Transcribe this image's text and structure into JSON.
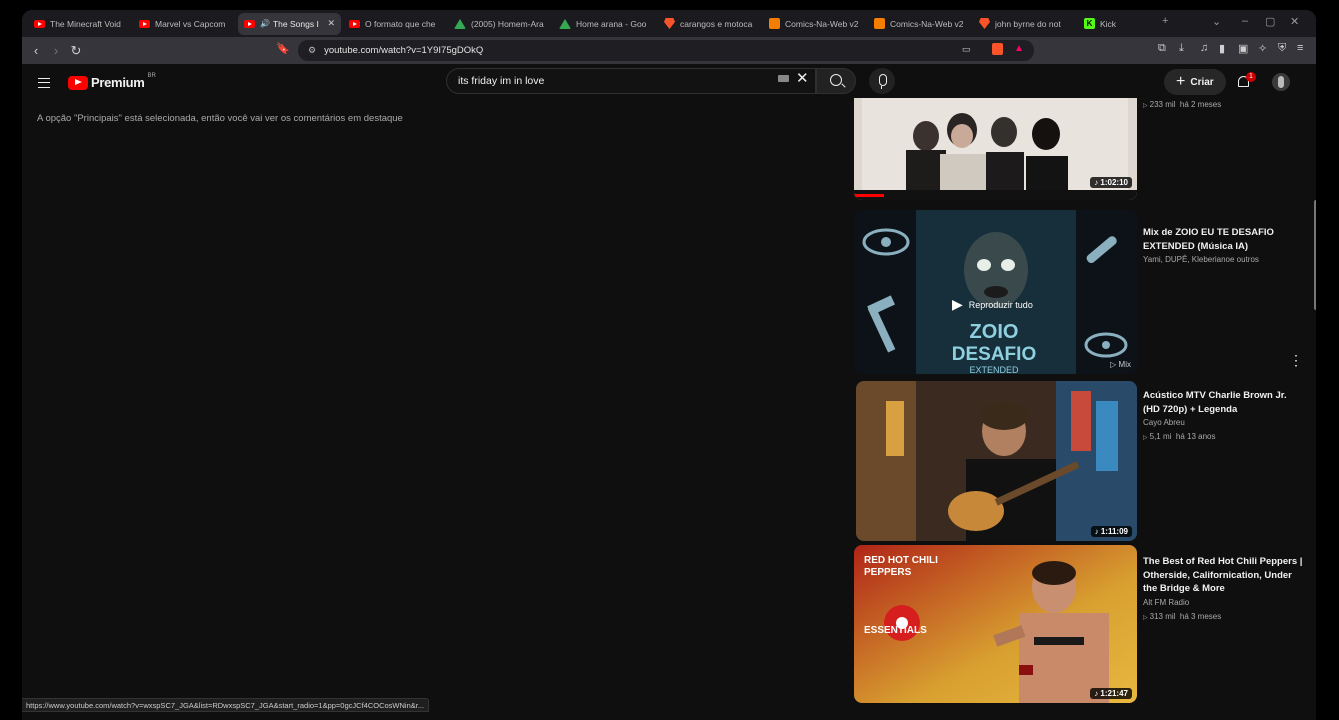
{
  "browser": {
    "tabs": [
      {
        "title": "The Minecraft Void",
        "favicon": "youtube-icon",
        "active": false
      },
      {
        "title": "Marvel vs Capcom",
        "favicon": "youtube-icon",
        "active": false
      },
      {
        "title": "The Songs I",
        "favicon": "youtube-icon",
        "active": true,
        "audio": true
      },
      {
        "title": "O formato que che",
        "favicon": "youtube-icon",
        "active": false
      },
      {
        "title": "(2005) Homem-Ara",
        "favicon": "drive-icon",
        "active": false
      },
      {
        "title": "Home arana - Goo",
        "favicon": "drive-icon",
        "active": false
      },
      {
        "title": "carangos e motoca",
        "favicon": "brave-icon",
        "active": false
      },
      {
        "title": "Comics-Na-Web v2",
        "favicon": "blogger-icon",
        "active": false
      },
      {
        "title": "Comics-Na-Web v2",
        "favicon": "blogger-icon",
        "active": false
      },
      {
        "title": "john byrne do not",
        "favicon": "brave-icon",
        "active": false
      },
      {
        "title": "Kick",
        "favicon": "kick-icon",
        "active": false
      }
    ],
    "url": "youtube.com/watch?v=1Y9I75gDOkQ",
    "status_url": "https://www.youtube.com/watch?v=wxspSC7_JGA&list=RDwxspSC7_JGA&start_radio=1&pp=0gcJCf4COCosWNin&r..."
  },
  "youtube": {
    "logo_text": "Premium",
    "region": "BR",
    "search_query": "its friday im in love",
    "create_label": "Criar",
    "notification_count": "1"
  },
  "main": {
    "comments_note": "A opção \"Principais\" está selecionada, então você vai ver os comentários em destaque"
  },
  "recommendations": [
    {
      "title": "",
      "channel": "",
      "views": "233 mil",
      "age": "há 2 meses",
      "duration": "1:02:10"
    },
    {
      "title": "Mix de ZOIO EU TE DESAFIO EXTENDED (Música IA)",
      "channel": "Yami, DUPÊ, Kleberianoe outros",
      "overlay": "Reproduzir tudo",
      "badge": "Mix",
      "thumb_art": {
        "line1": "ZOIO",
        "line2": "DESAFIO",
        "line3": "EXTENDED"
      }
    },
    {
      "title": "Acústico MTV Charlie Brown Jr. (HD 720p) + Legenda",
      "channel": "Cayo Abreu",
      "views": "5,1 mi",
      "age": "há 13 anos",
      "duration": "1:11:09"
    },
    {
      "title": "The Best of Red Hot Chili Peppers | Otherside, Californication, Under the Bridge & More",
      "channel": "Alt FM Radio",
      "views": "313 mil",
      "age": "há 3 meses",
      "duration": "1:21:47",
      "thumb_art": {
        "line1": "RED HOT CHILI PEPPERS",
        "line2": "ESSENTIALS"
      }
    }
  ],
  "colors": {
    "youtube_red": "#ff0000",
    "background": "#0f0f0f",
    "badge_red": "#cc0000"
  }
}
